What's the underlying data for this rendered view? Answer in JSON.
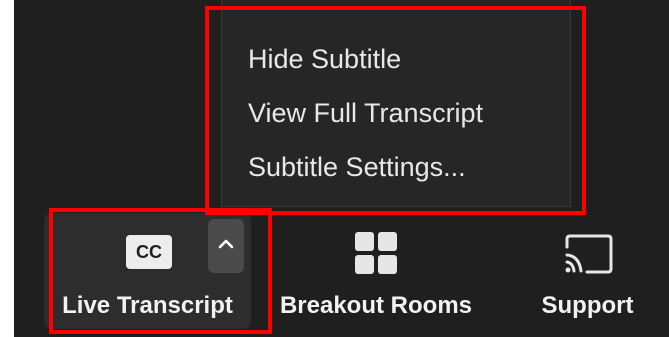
{
  "menu": {
    "items": [
      {
        "label": "Hide Subtitle"
      },
      {
        "label": "View Full Transcript"
      },
      {
        "label": "Subtitle Settings..."
      }
    ]
  },
  "toolbar": {
    "live_transcript": {
      "label": "Live Transcript",
      "icon_text": "CC",
      "icon": "cc-icon"
    },
    "breakout_rooms": {
      "label": "Breakout Rooms",
      "icon": "grid-icon"
    },
    "support": {
      "label": "Support",
      "icon": "cast-icon"
    }
  },
  "colors": {
    "background": "#1f1f1f",
    "menu_background": "#262626",
    "highlight": "#ff0000",
    "text": "#e8e8e8"
  }
}
